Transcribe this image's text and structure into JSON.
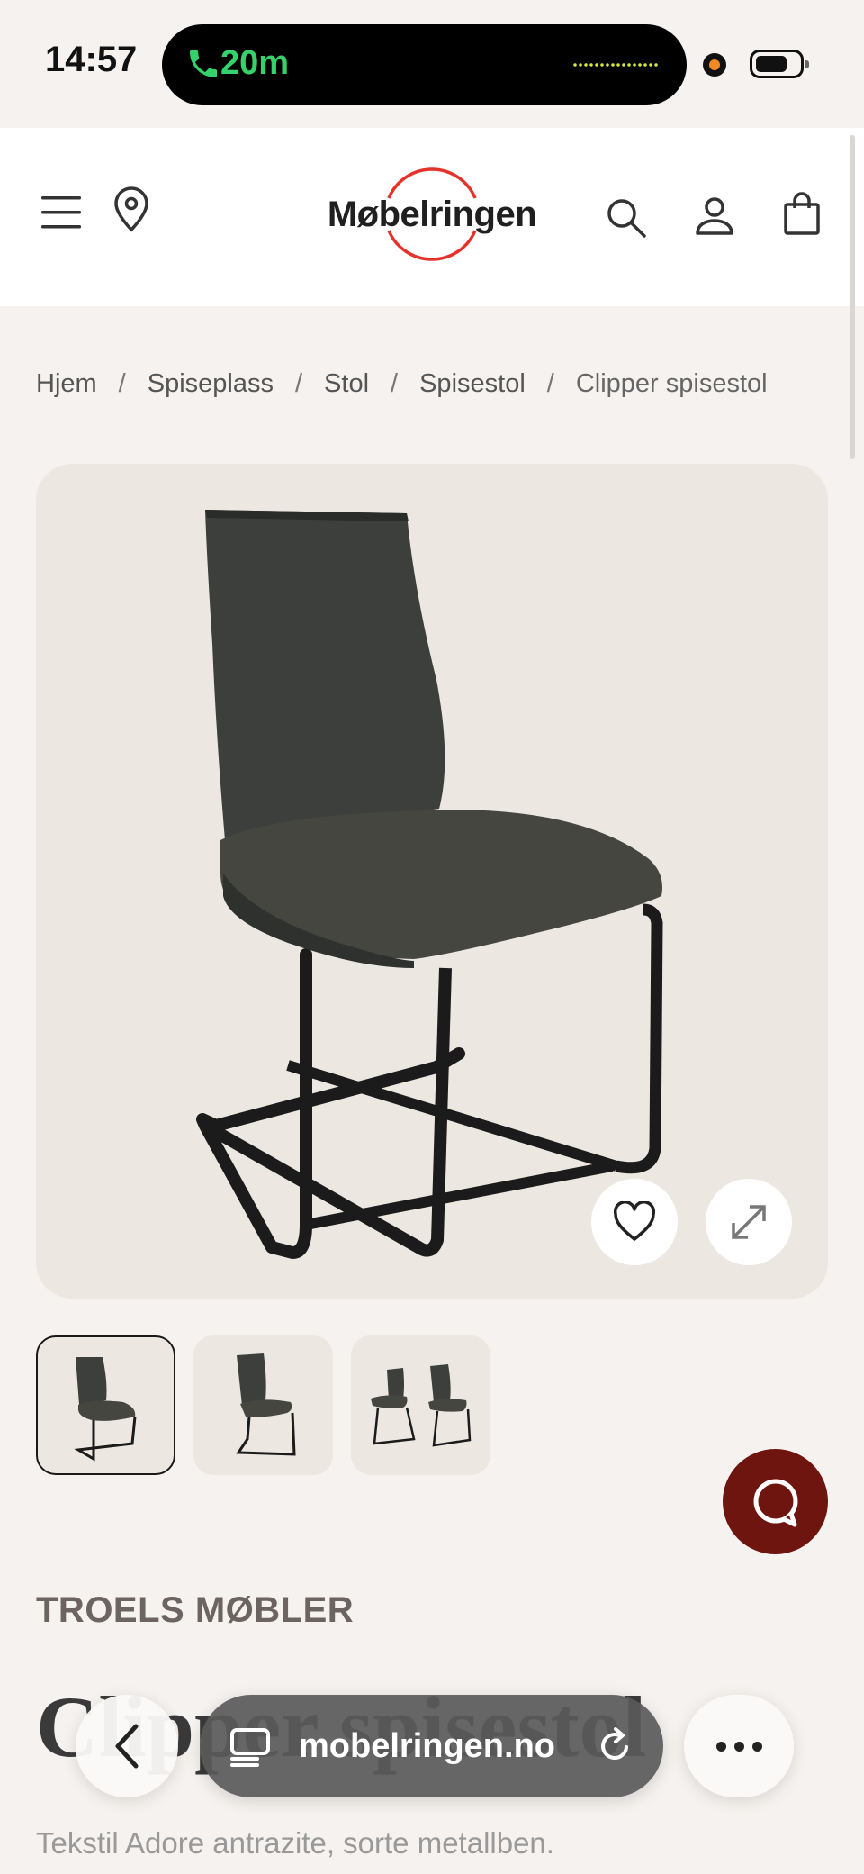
{
  "status_bar": {
    "time": "14:57",
    "call_duration": "20m"
  },
  "header": {
    "logo_text": "Møbelringen",
    "brand_color": "#e5332a",
    "icons": [
      "menu-icon",
      "location-pin-icon",
      "search-icon",
      "user-icon",
      "shopping-bag-icon"
    ]
  },
  "breadcrumb": {
    "items": [
      "Hjem",
      "Spiseplass",
      "Stol",
      "Spisestol"
    ],
    "separator": "/",
    "current": "Clipper spisestol"
  },
  "product": {
    "brand": "TROELS MØBLER",
    "title": "Clipper spisestol",
    "subtitle": "Tekstil Adore antrazite, sorte metallben.",
    "thumbnail_count": 3,
    "active_thumbnail": 1
  },
  "chat": {
    "button_color": "#6e1510"
  },
  "browser": {
    "url": "mobelringen.no"
  }
}
